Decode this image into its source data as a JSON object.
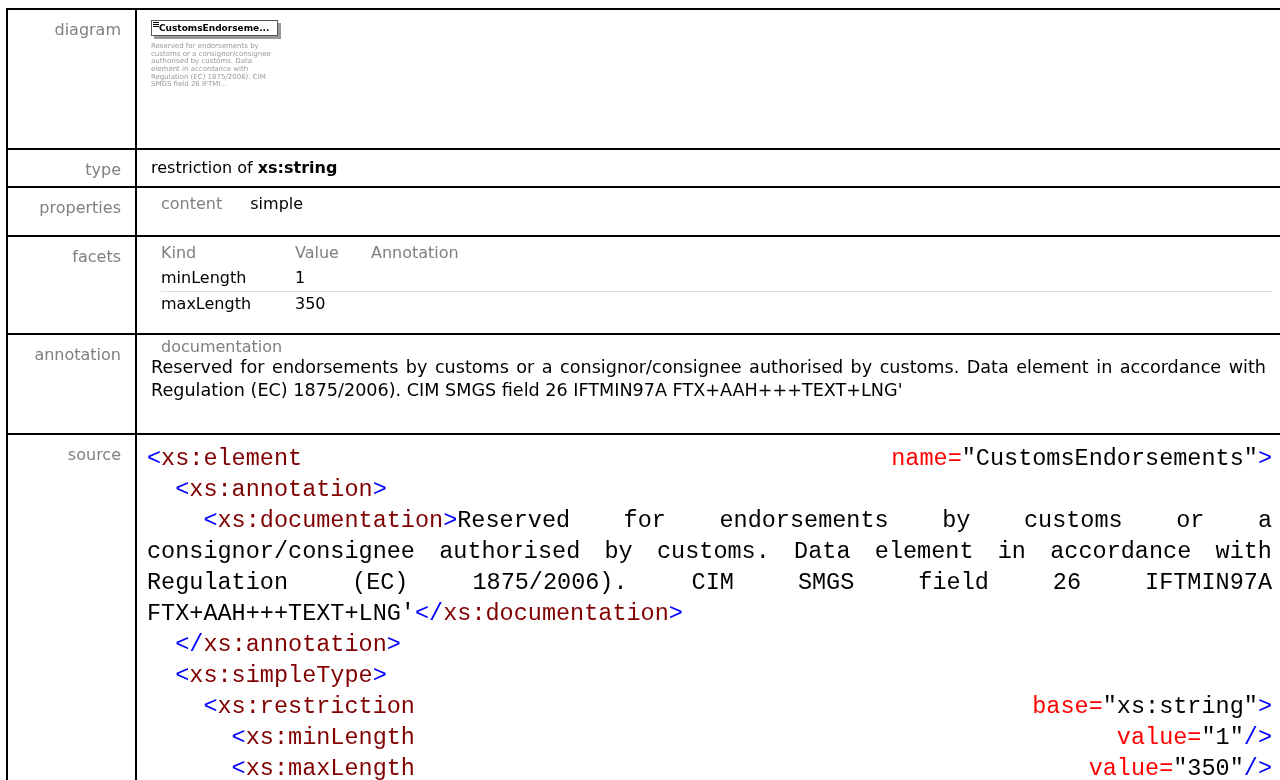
{
  "diagram": {
    "label": "diagram",
    "element_label": "CustomsEndorseme...",
    "description": "Reserved for endorsements by customs or a consignor/consignee authorised by customs. Data element in accordance with Regulation (EC) 1875/2006). CIM SMGS field 26 IFTMI..."
  },
  "type": {
    "label": "type",
    "text": "restriction of **xs:string**"
  },
  "properties": {
    "label": "properties",
    "items": [
      {
        "name": "content",
        "value": "simple"
      }
    ]
  },
  "facets": {
    "label": "facets",
    "columns": [
      "Kind",
      "Value",
      "Annotation"
    ],
    "rows": [
      {
        "kind": "minLength",
        "value": "1"
      },
      {
        "kind": "maxLength",
        "value": "350"
      }
    ]
  },
  "annotation": {
    "label": "annotation",
    "heading": "documentation",
    "text": "Reserved for endorsements by customs or a consignor/consignee authorised by customs. Data element in accordance with Regulation (EC) 1875/2006). CIM SMGS field 26 IFTMIN97A FTX+AAH+++TEXT+LNG'"
  },
  "source": {
    "label": "source",
    "lines": [
      {
        "words": [
          [
            {
              "kind": "punct",
              "text": "<"
            },
            {
              "kind": "tag",
              "text": "xs:element"
            }
          ],
          [
            {
              "kind": "attr",
              "text": "name="
            },
            {
              "kind": "value",
              "text": "\"CustomsEndorsements\""
            },
            {
              "kind": "punct",
              "text": ">"
            }
          ]
        ]
      },
      {
        "words": [
          [
            {
              "kind": "punct",
              "text": "  <"
            },
            {
              "kind": "tag",
              "text": "xs:annotation"
            },
            {
              "kind": "punct",
              "text": ">"
            }
          ]
        ]
      },
      {
        "words": [
          [
            {
              "kind": "punct",
              "text": "    <"
            },
            {
              "kind": "tag",
              "text": "xs:documentation"
            },
            {
              "kind": "punct",
              "text": ">"
            },
            {
              "kind": "text",
              "text": "Reserved"
            }
          ],
          [
            {
              "kind": "text",
              "text": "for"
            }
          ],
          [
            {
              "kind": "text",
              "text": "endorsements"
            }
          ],
          [
            {
              "kind": "text",
              "text": "by"
            }
          ],
          [
            {
              "kind": "text",
              "text": "customs"
            }
          ],
          [
            {
              "kind": "text",
              "text": "or"
            }
          ],
          [
            {
              "kind": "text",
              "text": "a"
            }
          ]
        ]
      },
      {
        "words": [
          [
            {
              "kind": "text",
              "text": "consignor/consignee"
            }
          ],
          [
            {
              "kind": "text",
              "text": "authorised"
            }
          ],
          [
            {
              "kind": "text",
              "text": "by"
            }
          ],
          [
            {
              "kind": "text",
              "text": "customs."
            }
          ],
          [
            {
              "kind": "text",
              "text": "Data"
            }
          ],
          [
            {
              "kind": "text",
              "text": "element"
            }
          ],
          [
            {
              "kind": "text",
              "text": "in"
            }
          ],
          [
            {
              "kind": "text",
              "text": "accordance"
            }
          ],
          [
            {
              "kind": "text",
              "text": "with"
            }
          ]
        ]
      },
      {
        "words": [
          [
            {
              "kind": "text",
              "text": "Regulation"
            }
          ],
          [
            {
              "kind": "text",
              "text": "(EC)"
            }
          ],
          [
            {
              "kind": "text",
              "text": "1875/2006)."
            }
          ],
          [
            {
              "kind": "text",
              "text": "CIM"
            }
          ],
          [
            {
              "kind": "text",
              "text": "SMGS"
            }
          ],
          [
            {
              "kind": "text",
              "text": "field"
            }
          ],
          [
            {
              "kind": "text",
              "text": "26"
            }
          ],
          [
            {
              "kind": "text",
              "text": "IFTMIN97A"
            }
          ]
        ]
      },
      {
        "words": [
          [
            {
              "kind": "text",
              "text": "FTX+AAH+++TEXT+LNG'"
            },
            {
              "kind": "punct",
              "text": "</"
            },
            {
              "kind": "tag",
              "text": "xs:documentation"
            },
            {
              "kind": "punct",
              "text": ">"
            }
          ]
        ]
      },
      {
        "words": [
          [
            {
              "kind": "punct",
              "text": "  </"
            },
            {
              "kind": "tag",
              "text": "xs:annotation"
            },
            {
              "kind": "punct",
              "text": ">"
            }
          ]
        ]
      },
      {
        "words": [
          [
            {
              "kind": "punct",
              "text": "  <"
            },
            {
              "kind": "tag",
              "text": "xs:simpleType"
            },
            {
              "kind": "punct",
              "text": ">"
            }
          ]
        ]
      },
      {
        "words": [
          [
            {
              "kind": "punct",
              "text": "    <"
            },
            {
              "kind": "tag",
              "text": "xs:restriction"
            }
          ],
          [
            {
              "kind": "attr",
              "text": "base="
            },
            {
              "kind": "value",
              "text": "\"xs:string\""
            },
            {
              "kind": "punct",
              "text": ">"
            }
          ]
        ]
      },
      {
        "words": [
          [
            {
              "kind": "punct",
              "text": "      <"
            },
            {
              "kind": "tag",
              "text": "xs:minLength"
            }
          ],
          [
            {
              "kind": "attr",
              "text": "value="
            },
            {
              "kind": "value",
              "text": "\"1\""
            },
            {
              "kind": "punct",
              "text": "/>"
            }
          ]
        ]
      },
      {
        "words": [
          [
            {
              "kind": "punct",
              "text": "      <"
            },
            {
              "kind": "tag",
              "text": "xs:maxLength"
            }
          ],
          [
            {
              "kind": "attr",
              "text": "value="
            },
            {
              "kind": "value",
              "text": "\"350\""
            },
            {
              "kind": "punct",
              "text": "/>"
            }
          ]
        ]
      }
    ]
  }
}
